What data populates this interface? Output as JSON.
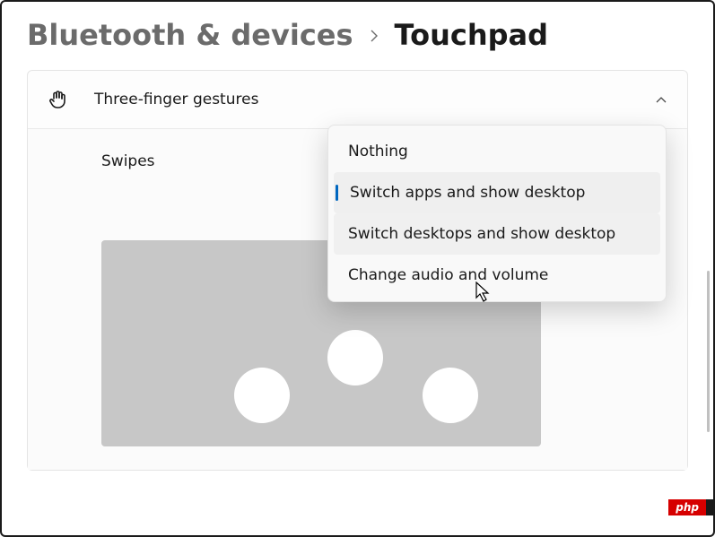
{
  "breadcrumb": {
    "parent": "Bluetooth & devices",
    "current": "Touchpad"
  },
  "section": {
    "title": "Three-finger gestures",
    "expanded": true
  },
  "setting": {
    "label": "Swipes"
  },
  "dropdown": {
    "options": [
      {
        "label": "Nothing",
        "selected": false,
        "hovered": false
      },
      {
        "label": "Switch apps and show desktop",
        "selected": true,
        "hovered": false
      },
      {
        "label": "Switch desktops and show desktop",
        "selected": false,
        "hovered": true
      },
      {
        "label": "Change audio and volume",
        "selected": false,
        "hovered": false
      }
    ]
  },
  "watermark": "php"
}
